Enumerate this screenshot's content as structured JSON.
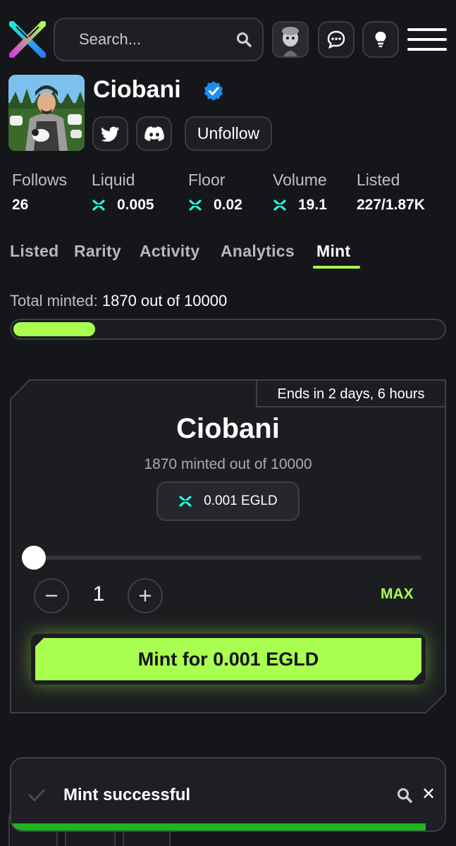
{
  "colors": {
    "accent": "#a8ff50",
    "background": "#15161a",
    "egld": "#23f7dd",
    "verified": "#1d8cf0",
    "toast_progress": "#1db81d"
  },
  "header": {
    "search_placeholder": "Search...",
    "icons": [
      "x-logo-icon",
      "search-icon",
      "user-avatar",
      "chat-icon",
      "lightbulb-icon",
      "menu-icon"
    ]
  },
  "collection": {
    "name": "Ciobani",
    "verified": true,
    "unfollow_label": "Unfollow",
    "social": [
      "twitter-icon",
      "discord-icon"
    ]
  },
  "stats": [
    {
      "label": "Follows",
      "value": "26",
      "egld": false
    },
    {
      "label": "Liquid",
      "value": "0.005",
      "egld": true
    },
    {
      "label": "Floor",
      "value": "0.02",
      "egld": true
    },
    {
      "label": "Volume",
      "value": "19.1",
      "egld": true
    },
    {
      "label": "Listed",
      "value": "227/1.87K",
      "egld": false
    }
  ],
  "tabs": [
    {
      "label": "Listed",
      "active": false
    },
    {
      "label": "Rarity",
      "active": false
    },
    {
      "label": "Activity",
      "active": false
    },
    {
      "label": "Analytics",
      "active": false
    },
    {
      "label": "Mint",
      "active": true
    }
  ],
  "mint_progress": {
    "label": "Total minted:",
    "value": "1870 out of 10000",
    "minted": 1870,
    "total": 10000,
    "bar_fill_fraction": 0.19
  },
  "mint_card": {
    "ends_label": "Ends in 2 days, 6 hours",
    "title": "Ciobani",
    "subtitle": "1870 minted out of 10000",
    "price": "0.001 EGLD",
    "slider_value": 1,
    "quantity": "1",
    "max_label": "MAX",
    "mint_button_label": "Mint for 0.001 EGLD"
  },
  "toast": {
    "message": "Mint successful",
    "progress_fraction": 0.95
  }
}
